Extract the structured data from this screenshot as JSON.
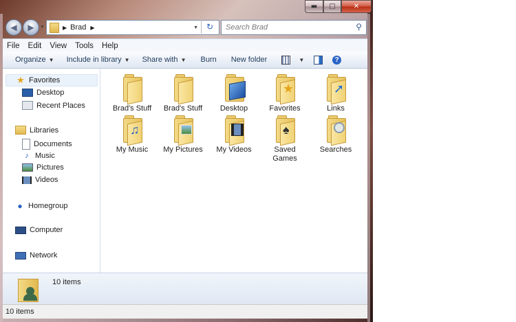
{
  "window": {
    "caption": {
      "minimize": "▬",
      "maximize": "□",
      "close": "✕"
    }
  },
  "navigation": {
    "back_glyph": "◀",
    "forward_glyph": "▶",
    "address_segments": [
      "Brad"
    ],
    "refresh_glyph": "↻",
    "search_placeholder": "Search Brad"
  },
  "menubar": {
    "items": [
      "File",
      "Edit",
      "View",
      "Tools",
      "Help"
    ]
  },
  "toolbar": {
    "organize": "Organize",
    "include_in_library": "Include in library",
    "share_with": "Share with",
    "burn": "Burn",
    "new_folder": "New folder"
  },
  "navpane": {
    "favorites": {
      "label": "Favorites",
      "items": [
        "Desktop",
        "Recent Places"
      ]
    },
    "libraries": {
      "label": "Libraries",
      "items": [
        "Documents",
        "Music",
        "Pictures",
        "Videos"
      ]
    },
    "homegroup": "Homegroup",
    "computer": "Computer",
    "network": "Network"
  },
  "files": [
    {
      "name": "Brad's Stuff",
      "icon": "folder-icon"
    },
    {
      "name": "Brad's Stuff",
      "icon": "folder-icon"
    },
    {
      "name": "Desktop",
      "icon": "desktop-folder-icon"
    },
    {
      "name": "Favorites",
      "icon": "favorites-folder-icon"
    },
    {
      "name": "Links",
      "icon": "links-folder-icon"
    },
    {
      "name": "My Music",
      "icon": "music-folder-icon"
    },
    {
      "name": "My Pictures",
      "icon": "pictures-folder-icon"
    },
    {
      "name": "My Videos",
      "icon": "videos-folder-icon"
    },
    {
      "name": "Saved Games",
      "icon": "saved-games-folder-icon"
    },
    {
      "name": "Searches",
      "icon": "searches-folder-icon"
    }
  ],
  "details_pane": {
    "count": "10 items"
  },
  "status": {
    "text": "10 items"
  },
  "colors": {
    "accent": "#1e395b",
    "folder": "#f0d275"
  }
}
